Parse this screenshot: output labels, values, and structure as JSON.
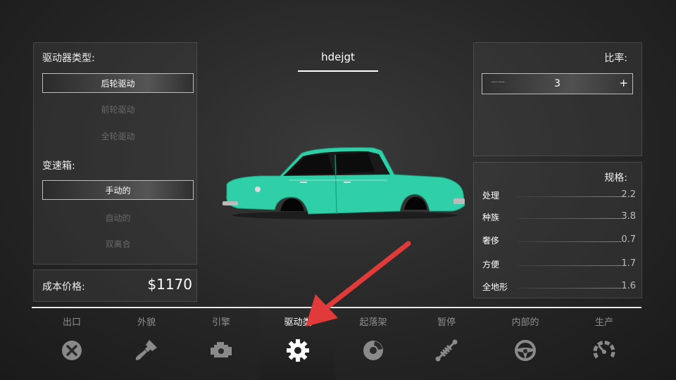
{
  "car_name": "hdejgt",
  "drive_panel": {
    "title": "驱动器类型:",
    "options": [
      "后轮驱动",
      "前轮驱动",
      "全轮驱动"
    ],
    "selected": 0,
    "gearbox_title": "变速箱:",
    "gearbox_options": [
      "手动的",
      "自动的",
      "双离合"
    ],
    "gearbox_selected": 0
  },
  "cost": {
    "label": "成本价格:",
    "value": "$1170"
  },
  "ratio": {
    "title": "比率:",
    "minus": "——",
    "value": "3",
    "plus": "+"
  },
  "specs": {
    "title": "规格:",
    "rows": [
      {
        "name": "处理",
        "value": "2.2"
      },
      {
        "name": "种族",
        "value": "3.8"
      },
      {
        "name": "奢侈",
        "value": "0.7"
      },
      {
        "name": "方便",
        "value": "1.7"
      },
      {
        "name": "全地形",
        "value": "1.6"
      }
    ]
  },
  "tabs": [
    {
      "label": "出口",
      "icon": "close-circle-icon"
    },
    {
      "label": "外貌",
      "icon": "paintbrush-icon"
    },
    {
      "label": "引擎",
      "icon": "engine-icon"
    },
    {
      "label": "驱动类",
      "icon": "gear-icon"
    },
    {
      "label": "起落架",
      "icon": "brake-disc-icon"
    },
    {
      "label": "暂停",
      "icon": "suspension-spring-icon"
    },
    {
      "label": "内部的",
      "icon": "steering-wheel-icon"
    },
    {
      "label": "生产",
      "icon": "gauge-icon"
    }
  ],
  "active_tab": 3,
  "colors": {
    "car_body": "#2fd0a8",
    "arrow": "#e03a3a"
  }
}
